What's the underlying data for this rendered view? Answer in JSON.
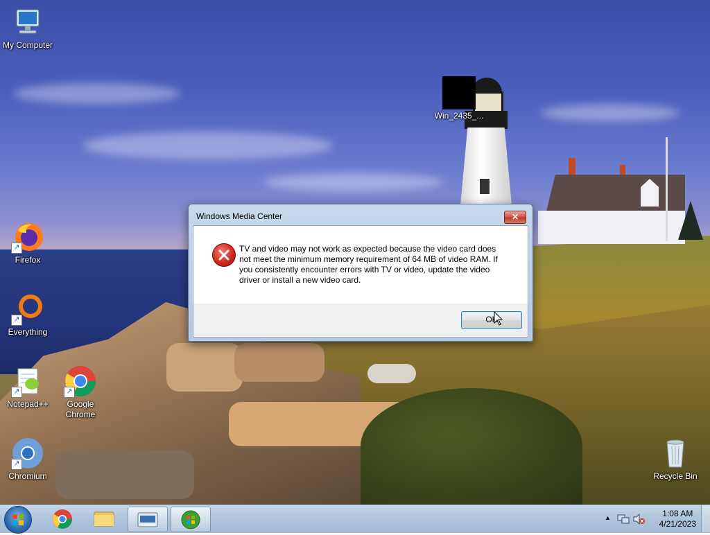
{
  "desktop": {
    "icons": [
      {
        "id": "my-computer",
        "label": "My Computer"
      },
      {
        "id": "win-file",
        "label": "Win_2435_..."
      },
      {
        "id": "firefox",
        "label": "Firefox"
      },
      {
        "id": "everything",
        "label": "Everything"
      },
      {
        "id": "notepadpp",
        "label": "Notepad++"
      },
      {
        "id": "chrome",
        "label": "Google\nChrome"
      },
      {
        "id": "chromium",
        "label": "Chromium"
      },
      {
        "id": "recycle-bin",
        "label": "Recycle Bin"
      }
    ]
  },
  "dialog": {
    "title": "Windows Media Center",
    "close_label": "✕",
    "message": "TV and video may not work as expected because the video card does not meet the minimum memory requirement of 64 MB of video RAM. If you consistently encounter errors with TV or video, update the video driver or install a new video card.",
    "ok_label": "OK"
  },
  "taskbar": {
    "clock_time": "1:08 AM",
    "clock_date": "4/21/2023",
    "tray_arrow": "▲"
  },
  "colors": {
    "error_red": "#d12a1e",
    "taskbar": "#b1c6de",
    "focus_border": "#3c7fb1"
  }
}
